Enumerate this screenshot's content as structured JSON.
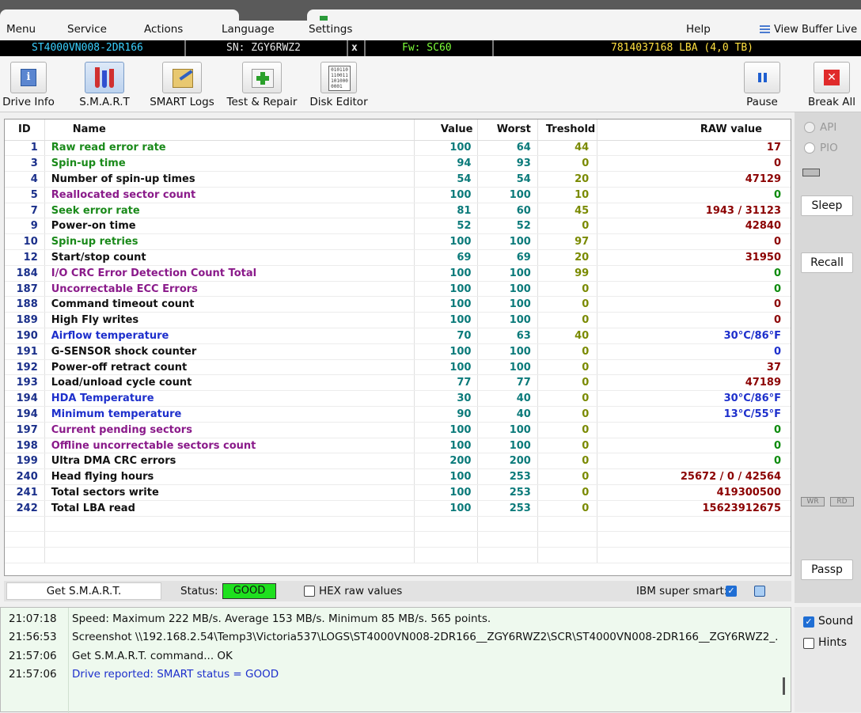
{
  "menu": {
    "items": [
      "Menu",
      "Service",
      "Actions",
      "Language",
      "Settings",
      "Help"
    ],
    "view_buffer": "View Buffer Live"
  },
  "drive": {
    "model": "ST4000VN008-2DR166",
    "serial": "SN: ZGY6RWZ2",
    "close": "x",
    "firmware": "Fw: SC60",
    "capacity": "7814037168 LBA (4,0 TB)"
  },
  "toolbar": {
    "drive_info": "Drive Info",
    "smart": "S.M.A.R.T",
    "smart_logs": "SMART Logs",
    "test_repair": "Test & Repair",
    "disk_editor": "Disk Editor",
    "pause": "Pause",
    "break_all": "Break All"
  },
  "table": {
    "headers": {
      "id": "ID",
      "name": "Name",
      "value": "Value",
      "worst": "Worst",
      "threshold": "Treshold",
      "raw": "RAW value"
    },
    "rows": [
      {
        "id": "1",
        "name": "Raw read error rate",
        "value": "100",
        "worst": "64",
        "threshold": "44",
        "raw": "17",
        "name_color": "green",
        "raw_color": "red"
      },
      {
        "id": "3",
        "name": "Spin-up time",
        "value": "94",
        "worst": "93",
        "threshold": "0",
        "raw": "0",
        "name_color": "green",
        "raw_color": "red"
      },
      {
        "id": "4",
        "name": "Number of spin-up times",
        "value": "54",
        "worst": "54",
        "threshold": "20",
        "raw": "47129",
        "name_color": "black",
        "raw_color": "red"
      },
      {
        "id": "5",
        "name": "Reallocated sector count",
        "value": "100",
        "worst": "100",
        "threshold": "10",
        "raw": "0",
        "name_color": "purple",
        "raw_color": "green"
      },
      {
        "id": "7",
        "name": "Seek error rate",
        "value": "81",
        "worst": "60",
        "threshold": "45",
        "raw": "1943 / 31123",
        "name_color": "green",
        "raw_color": "red"
      },
      {
        "id": "9",
        "name": "Power-on time",
        "value": "52",
        "worst": "52",
        "threshold": "0",
        "raw": "42840",
        "name_color": "black",
        "raw_color": "red"
      },
      {
        "id": "10",
        "name": "Spin-up retries",
        "value": "100",
        "worst": "100",
        "threshold": "97",
        "raw": "0",
        "name_color": "green",
        "raw_color": "red"
      },
      {
        "id": "12",
        "name": "Start/stop count",
        "value": "69",
        "worst": "69",
        "threshold": "20",
        "raw": "31950",
        "name_color": "black",
        "raw_color": "red"
      },
      {
        "id": "184",
        "name": "I/O CRC Error Detection Count Total",
        "value": "100",
        "worst": "100",
        "threshold": "99",
        "raw": "0",
        "name_color": "purple",
        "raw_color": "green"
      },
      {
        "id": "187",
        "name": "Uncorrectable ECC Errors",
        "value": "100",
        "worst": "100",
        "threshold": "0",
        "raw": "0",
        "name_color": "purple",
        "raw_color": "green"
      },
      {
        "id": "188",
        "name": "Command timeout count",
        "value": "100",
        "worst": "100",
        "threshold": "0",
        "raw": "0",
        "name_color": "black",
        "raw_color": "red"
      },
      {
        "id": "189",
        "name": "High Fly writes",
        "value": "100",
        "worst": "100",
        "threshold": "0",
        "raw": "0",
        "name_color": "black",
        "raw_color": "red"
      },
      {
        "id": "190",
        "name": "Airflow temperature",
        "value": "70",
        "worst": "63",
        "threshold": "40",
        "raw": "30°C/86°F",
        "name_color": "blue",
        "raw_color": "blue"
      },
      {
        "id": "191",
        "name": "G-SENSOR shock counter",
        "value": "100",
        "worst": "100",
        "threshold": "0",
        "raw": "0",
        "name_color": "black",
        "raw_color": "blue"
      },
      {
        "id": "192",
        "name": "Power-off retract count",
        "value": "100",
        "worst": "100",
        "threshold": "0",
        "raw": "37",
        "name_color": "black",
        "raw_color": "red"
      },
      {
        "id": "193",
        "name": "Load/unload cycle count",
        "value": "77",
        "worst": "77",
        "threshold": "0",
        "raw": "47189",
        "name_color": "black",
        "raw_color": "red"
      },
      {
        "id": "194",
        "name": "HDA Temperature",
        "value": "30",
        "worst": "40",
        "threshold": "0",
        "raw": "30°C/86°F",
        "name_color": "blue",
        "raw_color": "blue"
      },
      {
        "id": "194",
        "name": "Minimum temperature",
        "value": "90",
        "worst": "40",
        "threshold": "0",
        "raw": "13°C/55°F",
        "name_color": "blue",
        "raw_color": "blue"
      },
      {
        "id": "197",
        "name": "Current pending sectors",
        "value": "100",
        "worst": "100",
        "threshold": "0",
        "raw": "0",
        "name_color": "purple",
        "raw_color": "green"
      },
      {
        "id": "198",
        "name": "Offline uncorrectable sectors count",
        "value": "100",
        "worst": "100",
        "threshold": "0",
        "raw": "0",
        "name_color": "purple",
        "raw_color": "green"
      },
      {
        "id": "199",
        "name": "Ultra DMA CRC errors",
        "value": "200",
        "worst": "200",
        "threshold": "0",
        "raw": "0",
        "name_color": "black",
        "raw_color": "green"
      },
      {
        "id": "240",
        "name": "Head flying hours",
        "value": "100",
        "worst": "253",
        "threshold": "0",
        "raw": "25672 / 0 / 42564",
        "name_color": "black",
        "raw_color": "red"
      },
      {
        "id": "241",
        "name": "Total sectors write",
        "value": "100",
        "worst": "253",
        "threshold": "0",
        "raw": "419300500",
        "name_color": "black",
        "raw_color": "red"
      },
      {
        "id": "242",
        "name": "Total LBA read",
        "value": "100",
        "worst": "253",
        "threshold": "0",
        "raw": "15623912675",
        "name_color": "black",
        "raw_color": "red"
      }
    ]
  },
  "status": {
    "get_smart": "Get S.M.A.R.T.",
    "status_label": "Status:",
    "status_value": "GOOD",
    "hex_label": "HEX raw values",
    "ibm_label": "IBM super smart:"
  },
  "side": {
    "api": "API",
    "pio": "PIO",
    "sleep": "Sleep",
    "recall": "Recall",
    "passp": "Passp",
    "wr": "WR",
    "rd": "RD"
  },
  "log": [
    {
      "time": "21:07:18",
      "msg": "Speed: Maximum 222 MB/s. Average 153 MB/s. Minimum 85 MB/s. 565 points.",
      "color": "black"
    },
    {
      "time": "21:56:53",
      "msg": "Screenshot \\\\192.168.2.54\\Temp3\\Victoria537\\LOGS\\ST4000VN008-2DR166__ZGY6RWZ2\\SCR\\ST4000VN008-2DR166__ZGY6RWZ2_.",
      "color": "black"
    },
    {
      "time": "21:57:06",
      "msg": "Get S.M.A.R.T. command... OK",
      "color": "black"
    },
    {
      "time": "21:57:06",
      "msg": "Drive reported: SMART status = GOOD",
      "color": "blue"
    }
  ],
  "options": {
    "sound": "Sound",
    "hints": "Hints"
  },
  "colors": {
    "good": "#1ee01e",
    "info_cyan": "#3ad0ff",
    "info_green": "#7dff3a",
    "info_yellow": "#ffe040"
  }
}
